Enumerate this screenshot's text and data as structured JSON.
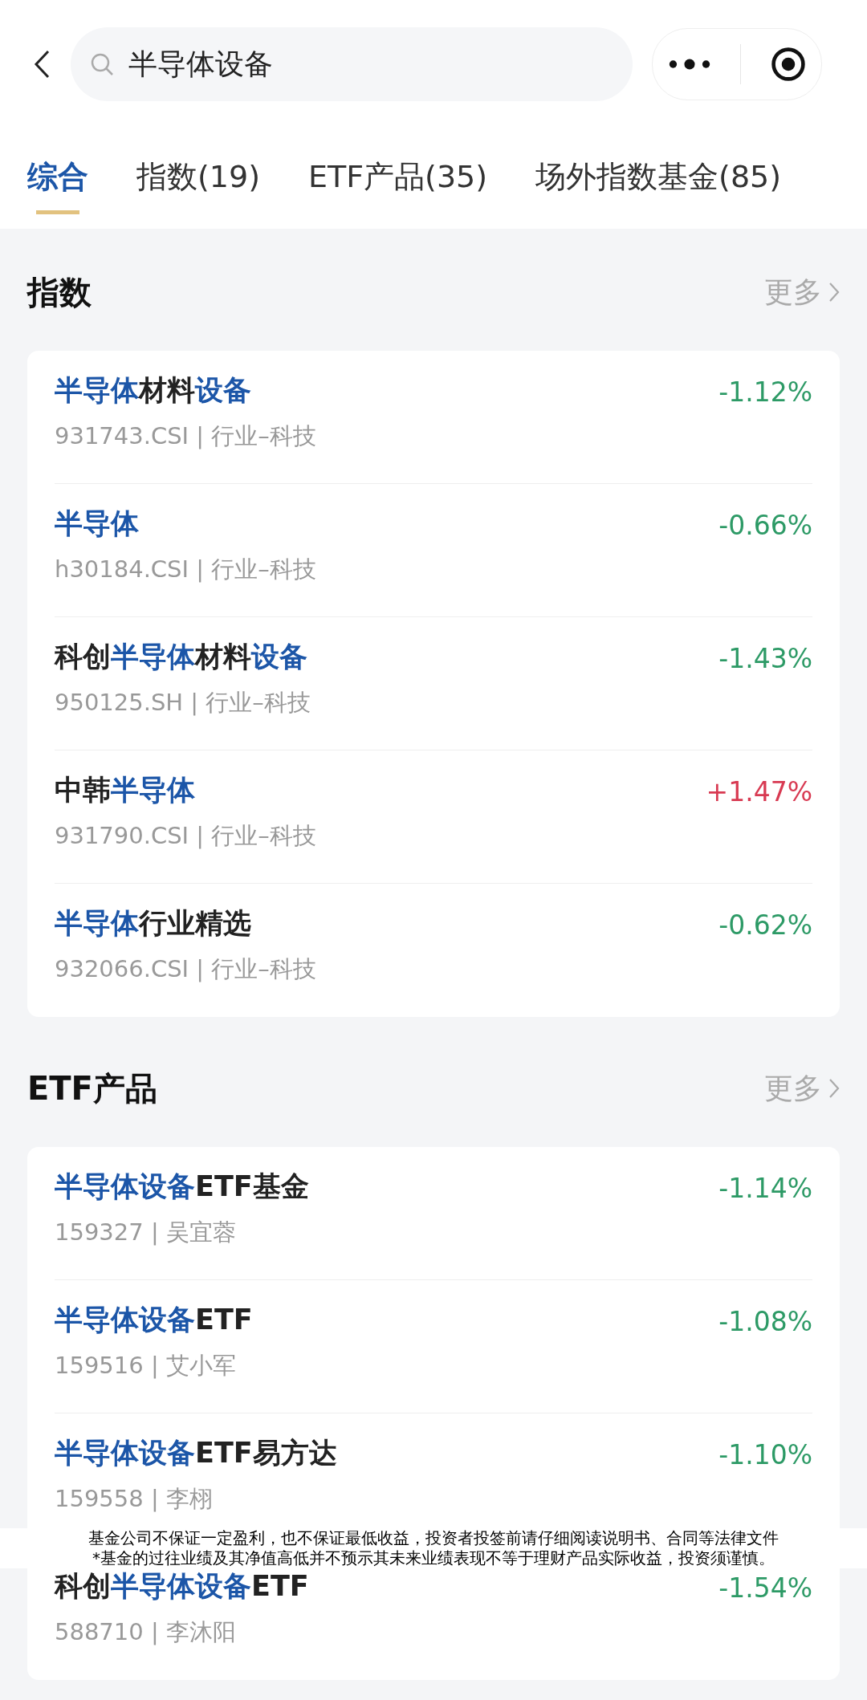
{
  "search": {
    "value": "半导体设备"
  },
  "tabs": [
    {
      "label": "综合",
      "selected": true
    },
    {
      "label": "指数(19)",
      "selected": false
    },
    {
      "label": "ETF产品(35)",
      "selected": false
    },
    {
      "label": "场外指数基金(85)",
      "selected": false
    }
  ],
  "sections": [
    {
      "title": "指数",
      "more": "更多",
      "items": [
        {
          "name": [
            {
              "text": "半导体",
              "highlight": true
            },
            {
              "text": "材料",
              "highlight": false
            },
            {
              "text": "设备",
              "highlight": true
            }
          ],
          "meta": "931743.CSI | 行业–科技",
          "change": "-1.12%",
          "color": "#2d9a66"
        },
        {
          "name": [
            {
              "text": "半导体",
              "highlight": true
            }
          ],
          "meta": "h30184.CSI | 行业–科技",
          "change": "-0.66%",
          "color": "#2d9a66"
        },
        {
          "name": [
            {
              "text": "科创",
              "highlight": false
            },
            {
              "text": "半导体",
              "highlight": true
            },
            {
              "text": "材料",
              "highlight": false
            },
            {
              "text": "设备",
              "highlight": true
            }
          ],
          "meta": "950125.SH | 行业–科技",
          "change": "-1.43%",
          "color": "#2d9a66"
        },
        {
          "name": [
            {
              "text": "中韩",
              "highlight": false
            },
            {
              "text": "半导体",
              "highlight": true
            }
          ],
          "meta": "931790.CSI | 行业–科技",
          "change": "+1.47%",
          "color": "#d83a52"
        },
        {
          "name": [
            {
              "text": "半导体",
              "highlight": true
            },
            {
              "text": "行业精选",
              "highlight": false
            }
          ],
          "meta": "932066.CSI | 行业–科技",
          "change": "-0.62%",
          "color": "#2d9a66"
        }
      ]
    },
    {
      "title": "ETF产品",
      "more": "更多",
      "items": [
        {
          "name": [
            {
              "text": "半导体设备",
              "highlight": true
            },
            {
              "text": "ETF基金",
              "highlight": false
            }
          ],
          "meta": "159327 | 吴宜蓉",
          "change": "-1.14%",
          "color": "#2d9a66"
        },
        {
          "name": [
            {
              "text": "半导体设备",
              "highlight": true
            },
            {
              "text": "ETF",
              "highlight": false
            }
          ],
          "meta": "159516 | 艾小军",
          "change": "-1.08%",
          "color": "#2d9a66"
        },
        {
          "name": [
            {
              "text": "半导体设备",
              "highlight": true
            },
            {
              "text": "ETF易方达",
              "highlight": false
            }
          ],
          "meta": "159558 | 李栩",
          "change": "-1.10%",
          "color": "#2d9a66"
        },
        {
          "name": [
            {
              "text": "科创",
              "highlight": false
            },
            {
              "text": "半导体设备",
              "highlight": true
            },
            {
              "text": "ETF",
              "highlight": false
            }
          ],
          "meta": "588710 | 李沐阳",
          "change": "-1.54%",
          "color": "#2d9a66"
        }
      ]
    }
  ],
  "disclaimer": [
    "基金公司不保证一定盈利，也不保证最低收益，投资者投签前请仔细阅读说明书、合同等法律文件",
    "*基金的过往业绩及其净值高低并不预示其未来业绩表现不等于理财产品实际收益，投资须谨慎。"
  ]
}
